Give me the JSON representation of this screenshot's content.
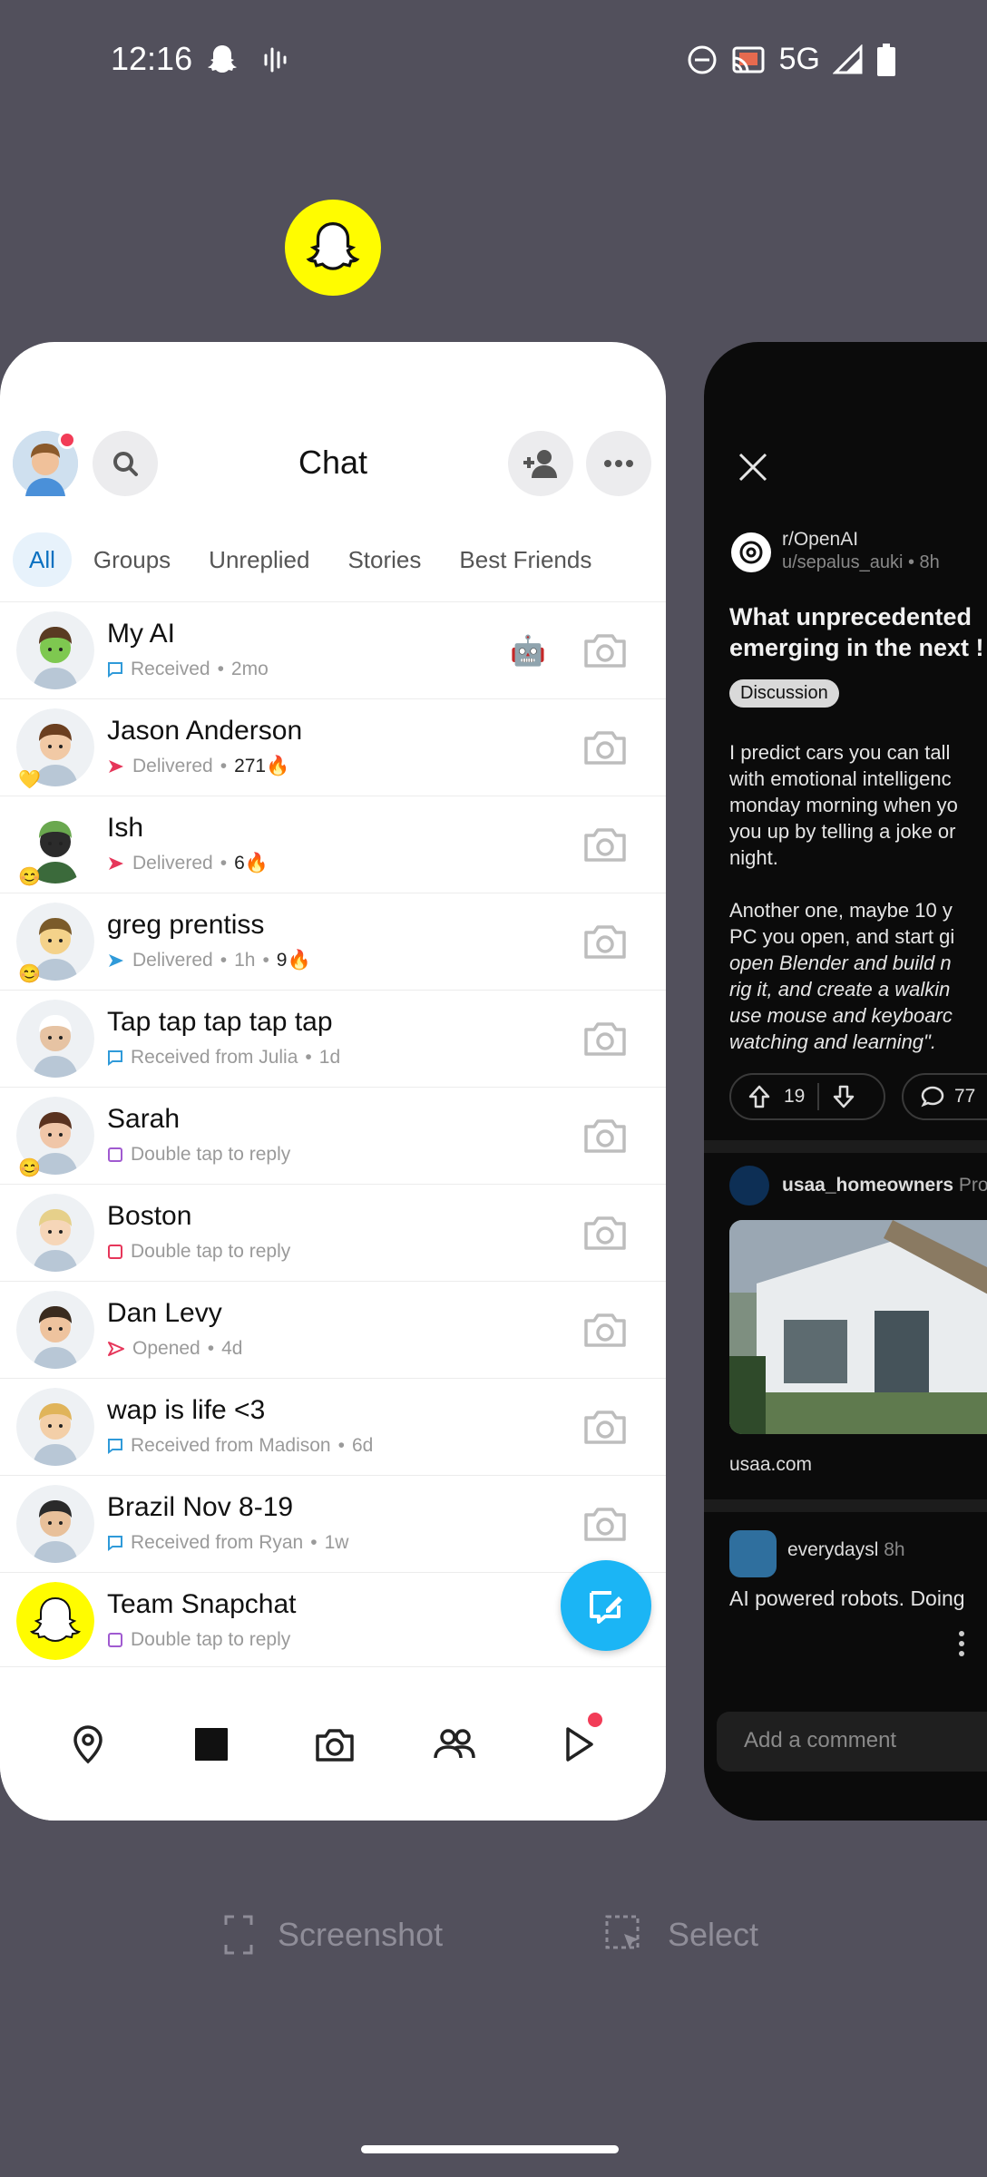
{
  "status_bar": {
    "time": "12:16",
    "network": "5G",
    "icons": [
      "snapchat-ghost-icon",
      "sound-wave-icon",
      "do-not-disturb-icon",
      "cast-icon",
      "signal-icon",
      "battery-icon"
    ]
  },
  "chat_app": {
    "title": "Chat",
    "tabs": [
      "All",
      "Groups",
      "Unreplied",
      "Stories",
      "Best Friends"
    ],
    "chats": [
      {
        "name": "My AI",
        "status": "Received",
        "time": "2mo",
        "streak": "",
        "status_color": "#2f9ad9"
      },
      {
        "name": "Jason Anderson",
        "status": "Delivered",
        "time": "",
        "streak": "271🔥",
        "status_color": "#e6365a"
      },
      {
        "name": "Ish",
        "status": "Delivered",
        "time": "",
        "streak": "6🔥",
        "status_color": "#e6365a"
      },
      {
        "name": "greg prentiss",
        "status": "Delivered",
        "time": "1h",
        "streak": "9🔥",
        "status_color": "#2f9ad9"
      },
      {
        "name": "Tap tap tap tap tap",
        "status": "Received from Julia",
        "time": "1d",
        "streak": "",
        "status_color": "#2f9ad9"
      },
      {
        "name": "Sarah",
        "status": "Double tap to reply",
        "time": "",
        "streak": "",
        "status_color": "#a05ad0"
      },
      {
        "name": "Boston",
        "status": "Double tap to reply",
        "time": "",
        "streak": "",
        "status_color": "#e6365a"
      },
      {
        "name": "Dan Levy",
        "status": "Opened",
        "time": "4d",
        "streak": "",
        "status_color": "#e6365a"
      },
      {
        "name": "wap is life <3",
        "status": "Received from Madison",
        "time": "6d",
        "streak": "",
        "status_color": "#2f9ad9"
      },
      {
        "name": "Brazil Nov 8-19",
        "status": "Received from Ryan",
        "time": "1w",
        "streak": "",
        "status_color": "#2f9ad9"
      },
      {
        "name": "Team Snapchat",
        "status": "Double tap to reply",
        "time": "",
        "streak": "",
        "status_color": "#a05ad0"
      }
    ],
    "dot": "•",
    "colors": {
      "accent": "#1bb5f5",
      "brand_yellow": "#fffc00",
      "badge": "#f23c57"
    }
  },
  "reddit_app": {
    "subreddit": "r/OpenAI",
    "user_time": "u/sepalus_auki • 8h",
    "title_lines": [
      "What unprecedented",
      "emerging in the next !"
    ],
    "flair": "Discussion",
    "body_p1": [
      "I predict cars you can tall",
      "with emotional intelligenc",
      "monday morning when yo",
      "you up by telling a joke or",
      "night."
    ],
    "body_p2_plain": [
      "Another one, maybe 10 y",
      "PC you open, and start gi"
    ],
    "body_p2_italic": [
      "open Blender and build n",
      "rig it, and create a walkin",
      "use mouse and keyboarc",
      "watching and learning\"."
    ],
    "upvotes": "19",
    "comments": "77",
    "ad_name": "usaa_homeowners",
    "ad_tag": "Pro",
    "ad_domain": "usaa.com",
    "post3_user": "everydaysl",
    "post3_time": "8h",
    "post3_text": "AI powered robots. Doing",
    "add_comment_placeholder": "Add a comment"
  },
  "actions": {
    "screenshot": "Screenshot",
    "select": "Select"
  }
}
